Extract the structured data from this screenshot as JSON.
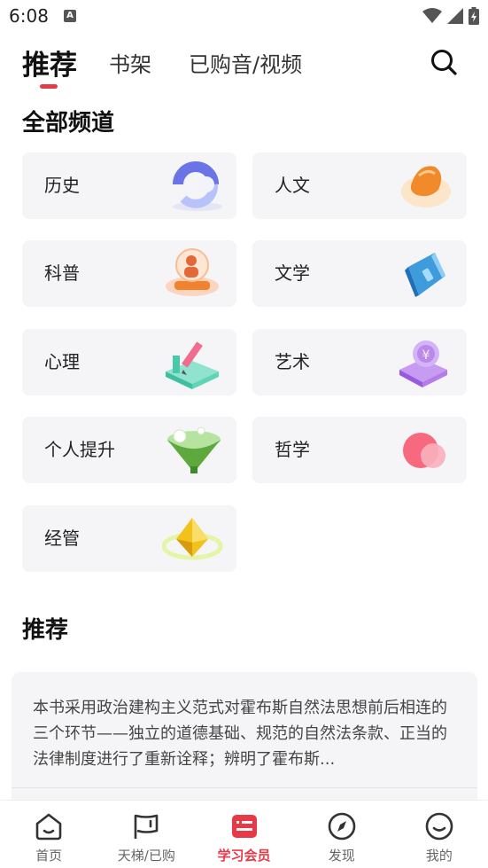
{
  "status_bar": {
    "time": "6:08",
    "notification_glyph": "A"
  },
  "top_tabs": {
    "items": [
      {
        "label": "推荐",
        "active": true
      },
      {
        "label": "书架",
        "active": false
      },
      {
        "label": "已购音/视频",
        "active": false
      }
    ],
    "search_icon": "search-icon"
  },
  "channels_section": {
    "title": "全部频道",
    "items": [
      {
        "label": "历史",
        "icon": "history-art"
      },
      {
        "label": "人文",
        "icon": "humanities-art"
      },
      {
        "label": "科普",
        "icon": "science-art"
      },
      {
        "label": "文学",
        "icon": "literature-art"
      },
      {
        "label": "心理",
        "icon": "psychology-art"
      },
      {
        "label": "艺术",
        "icon": "art-art"
      },
      {
        "label": "个人提升",
        "icon": "self-improvement-art"
      },
      {
        "label": "哲学",
        "icon": "philosophy-art"
      },
      {
        "label": "经管",
        "icon": "business-art"
      }
    ]
  },
  "recommend_section": {
    "title": "推荐",
    "card_text": "本书采用政治建构主义范式对霍布斯自然法思想前后相连的三个环节——独立的道德基础、规范的自然法条款、正当的法律制度进行了重新诠释；辨明了霍布斯..."
  },
  "bottom_nav": {
    "items": [
      {
        "label": "首页",
        "icon": "home-icon",
        "active": false
      },
      {
        "label": "天梯/已购",
        "icon": "flag-icon",
        "active": false
      },
      {
        "label": "学习会员",
        "icon": "member-icon",
        "active": true
      },
      {
        "label": "发现",
        "icon": "compass-icon",
        "active": false
      },
      {
        "label": "我的",
        "icon": "profile-icon",
        "active": false
      }
    ]
  },
  "colors": {
    "accent": "#e83a46",
    "card_bg": "#f5f5f7",
    "text": "#1d1d1f"
  }
}
